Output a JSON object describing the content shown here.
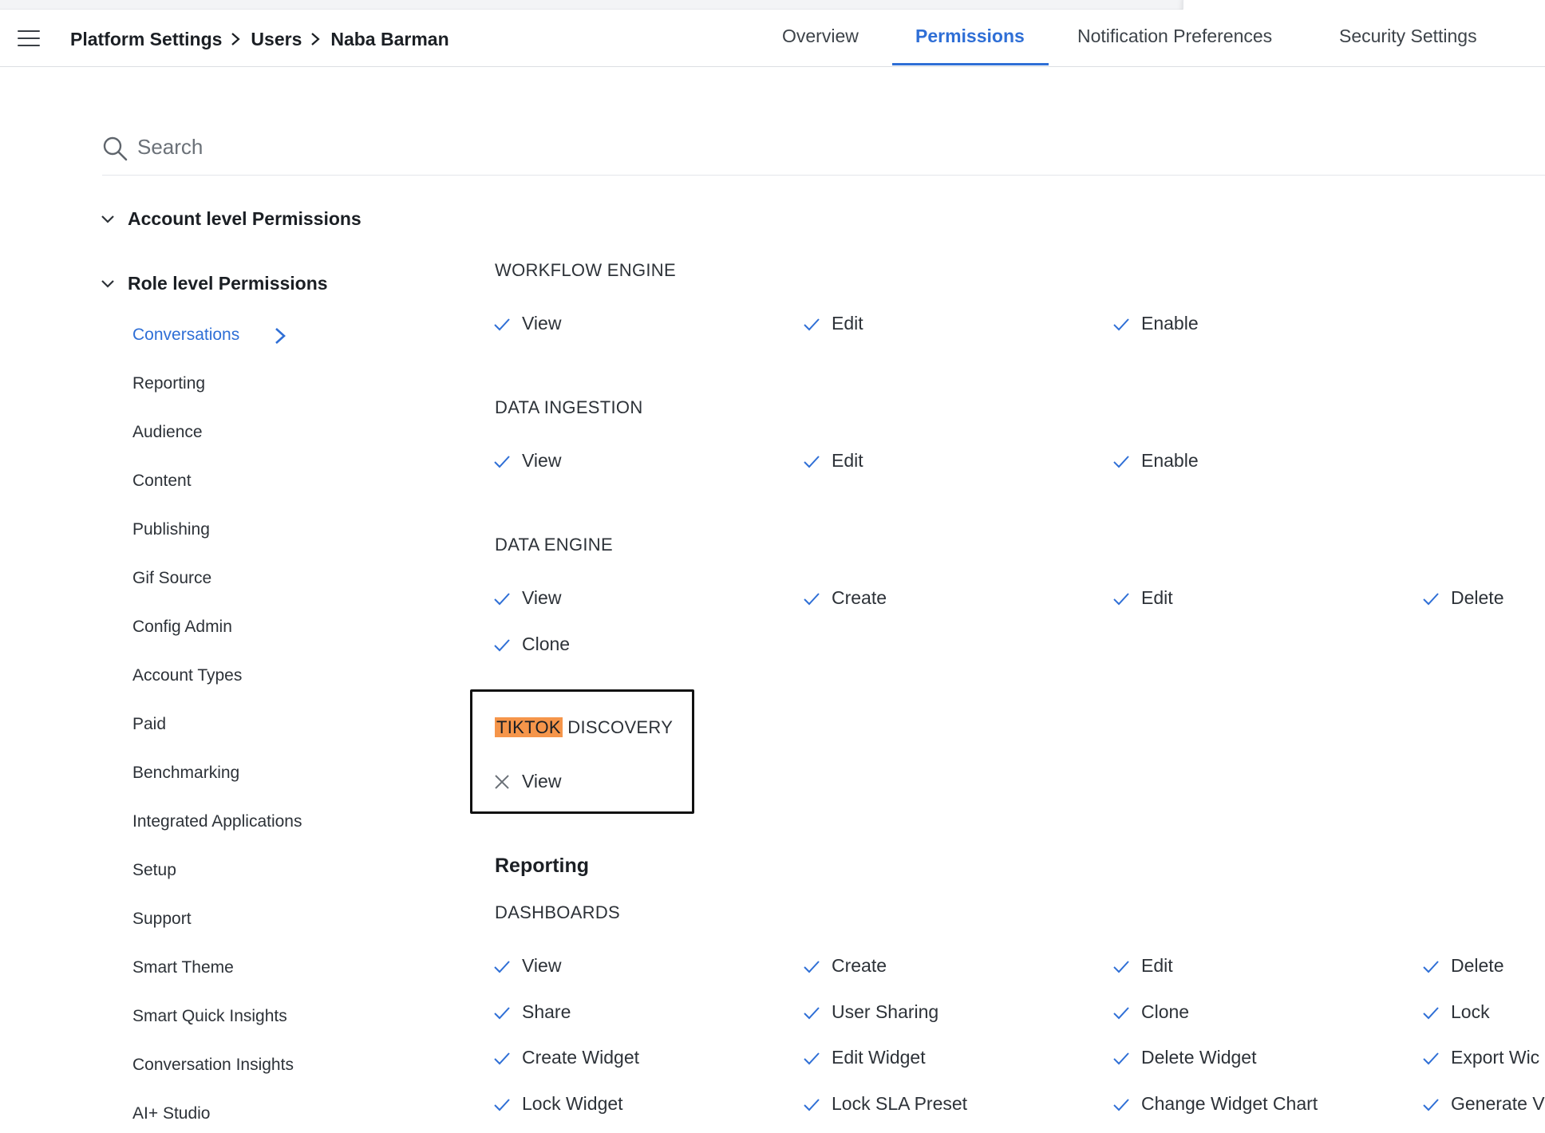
{
  "header": {
    "breadcrumb": [
      "Platform Settings",
      "Users",
      "Naba Barman"
    ],
    "tabs": [
      "Overview",
      "Permissions",
      "Notification Preferences",
      "Security Settings"
    ],
    "active_tab": "Permissions"
  },
  "search": {
    "placeholder": "Search"
  },
  "sections": {
    "account": "Account level Permissions",
    "role": "Role level Permissions"
  },
  "nav": {
    "items": [
      "Conversations",
      "Reporting",
      "Audience",
      "Content",
      "Publishing",
      "Gif Source",
      "Config Admin",
      "Account Types",
      "Paid",
      "Benchmarking",
      "Integrated Applications",
      "Setup",
      "Support",
      "Smart Theme",
      "Smart Quick Insights",
      "Conversation Insights",
      "AI+ Studio"
    ],
    "active": "Conversations"
  },
  "groups": {
    "workflow": {
      "title": "WORKFLOW ENGINE",
      "perms": [
        "View",
        "Edit",
        "Enable"
      ]
    },
    "ingestion": {
      "title": "DATA INGESTION",
      "perms": [
        "View",
        "Edit",
        "Enable"
      ]
    },
    "engine": {
      "title": "DATA ENGINE",
      "perms": [
        "View",
        "Create",
        "Edit",
        "Delete",
        "Clone"
      ]
    },
    "tiktok": {
      "title_highlight": "TIKTOK",
      "title_rest": "DISCOVERY",
      "perms": [
        "View"
      ]
    }
  },
  "reporting": {
    "heading": "Reporting",
    "dashboards": {
      "title": "DASHBOARDS",
      "perms": [
        "View",
        "Create",
        "Edit",
        "Delete",
        "Share",
        "User Sharing",
        "Clone",
        "Lock",
        "Create Widget",
        "Edit Widget",
        "Delete Widget",
        "Export Wic",
        "Lock Widget",
        "Lock SLA Preset",
        "Change Widget Chart",
        "Generate V"
      ]
    }
  },
  "colors": {
    "accent": "#2f6fd6",
    "highlight": "#f5954a",
    "check": "#2f6fd6",
    "cross": "#6b7178"
  }
}
